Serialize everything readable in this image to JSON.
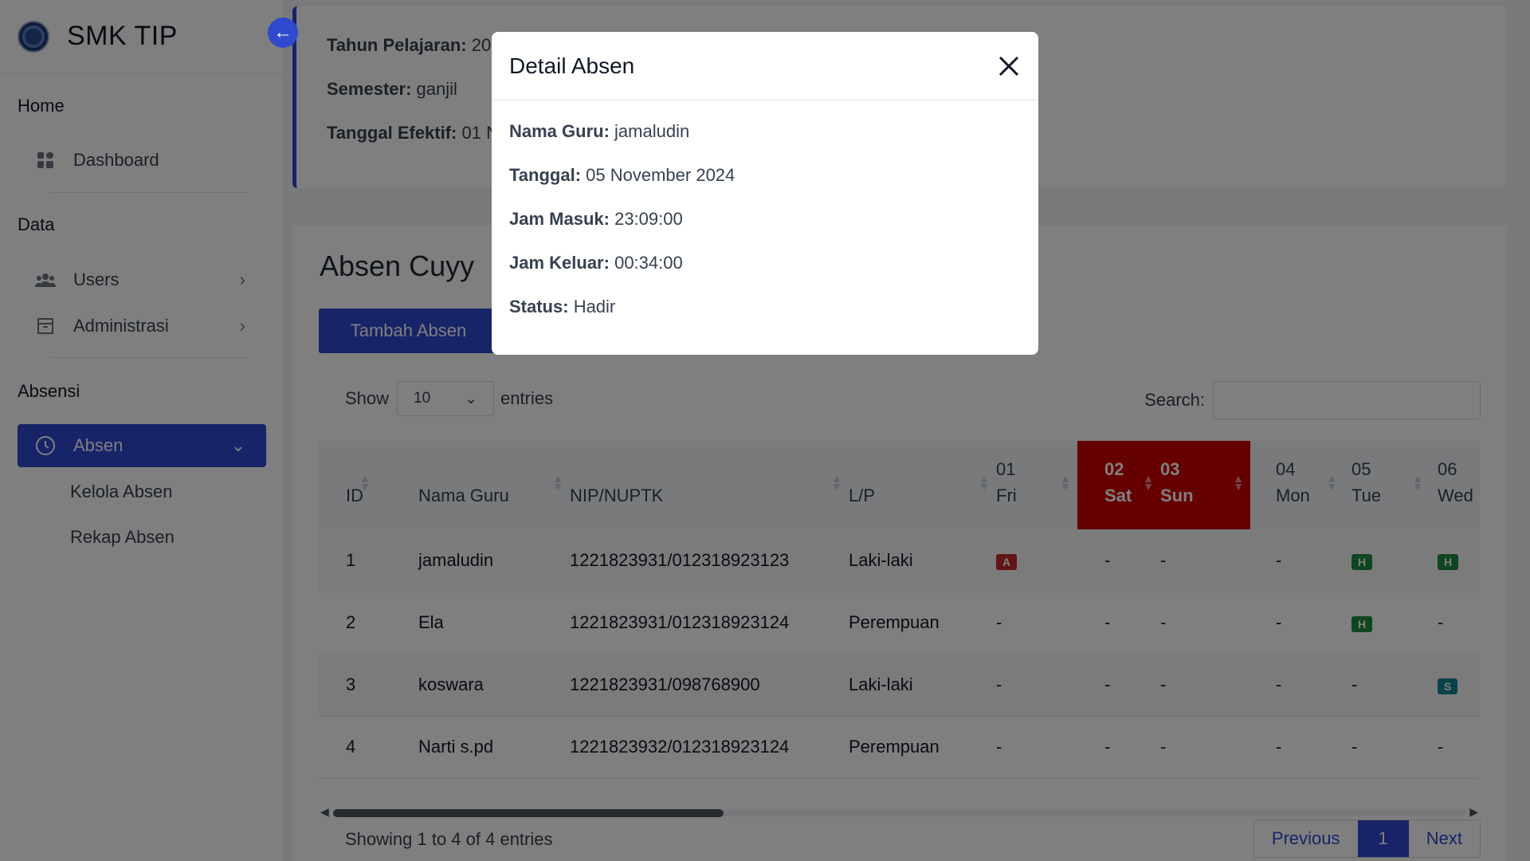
{
  "brand": {
    "name": "SMK TIP"
  },
  "sidebar": {
    "sections": [
      "Home",
      "Data",
      "Absensi"
    ],
    "items": [
      {
        "label": "Dashboard",
        "icon": "dashboard-icon"
      },
      {
        "label": "Users",
        "icon": "users-icon"
      },
      {
        "label": "Administrasi",
        "icon": "archive-icon"
      },
      {
        "label": "Absen",
        "icon": "clock-icon"
      }
    ],
    "subitems": [
      "Kelola Absen",
      "Rekap Absen"
    ]
  },
  "info": {
    "tahun_label": "Tahun Pelajaran:",
    "tahun_value": "20",
    "semester_label": "Semester:",
    "semester_value": "ganjil",
    "tanggal_label": "Tanggal Efektif:",
    "tanggal_value": "01 N"
  },
  "main": {
    "title": "Absen Cuyy",
    "add_button": "Tambah Absen",
    "show_label": "Show",
    "entries_value": "10",
    "entries_label": "entries",
    "search_label": "Search:",
    "footer": "Showing 1 to 4 of 4 entries",
    "pager": {
      "prev": "Previous",
      "current": "1",
      "next": "Next"
    }
  },
  "table": {
    "headers": {
      "id": "ID",
      "nama": "Nama Guru",
      "nip": "NIP/NUPTK",
      "lp": "L/P",
      "d1a": "01",
      "d1b": "Fri",
      "d2a": "02",
      "d2b": "Sat",
      "d3a": "03",
      "d3b": "Sun",
      "d4a": "04",
      "d4b": "Mon",
      "d5a": "05",
      "d5b": "Tue",
      "d6a": "06",
      "d6b": "Wed"
    },
    "rows": [
      {
        "id": "1",
        "nama": "jamaludin",
        "nip": "1221823931/012318923123",
        "lp": "Laki-laki",
        "d1": "A",
        "d2": "-",
        "d3": "-",
        "d4": "-",
        "d5": "H",
        "d6": "H"
      },
      {
        "id": "2",
        "nama": "Ela",
        "nip": "1221823931/012318923124",
        "lp": "Perempuan",
        "d1": "-",
        "d2": "-",
        "d3": "-",
        "d4": "-",
        "d5": "H",
        "d6": "-"
      },
      {
        "id": "3",
        "nama": "koswara",
        "nip": "1221823931/098768900",
        "lp": "Laki-laki",
        "d1": "-",
        "d2": "-",
        "d3": "-",
        "d4": "-",
        "d5": "-",
        "d6": "S"
      },
      {
        "id": "4",
        "nama": "Narti s.pd",
        "nip": "1221823932/012318923124",
        "lp": "Perempuan",
        "d1": "-",
        "d2": "-",
        "d3": "-",
        "d4": "-",
        "d5": "-",
        "d6": "-"
      }
    ]
  },
  "modal": {
    "title": "Detail Absen",
    "nama_label": "Nama Guru:",
    "nama_value": "jamaludin",
    "tanggal_label": "Tanggal:",
    "tanggal_value": "05 November 2024",
    "masuk_label": "Jam Masuk:",
    "masuk_value": "23:09:00",
    "keluar_label": "Jam Keluar:",
    "keluar_value": "00:34:00",
    "status_label": "Status:",
    "status_value": "Hadir"
  },
  "colors": {
    "accent": "#2f49d1",
    "weekend": "#cc0000",
    "absent": "#c62828",
    "present": "#1e8a3e",
    "sick": "#138496"
  }
}
